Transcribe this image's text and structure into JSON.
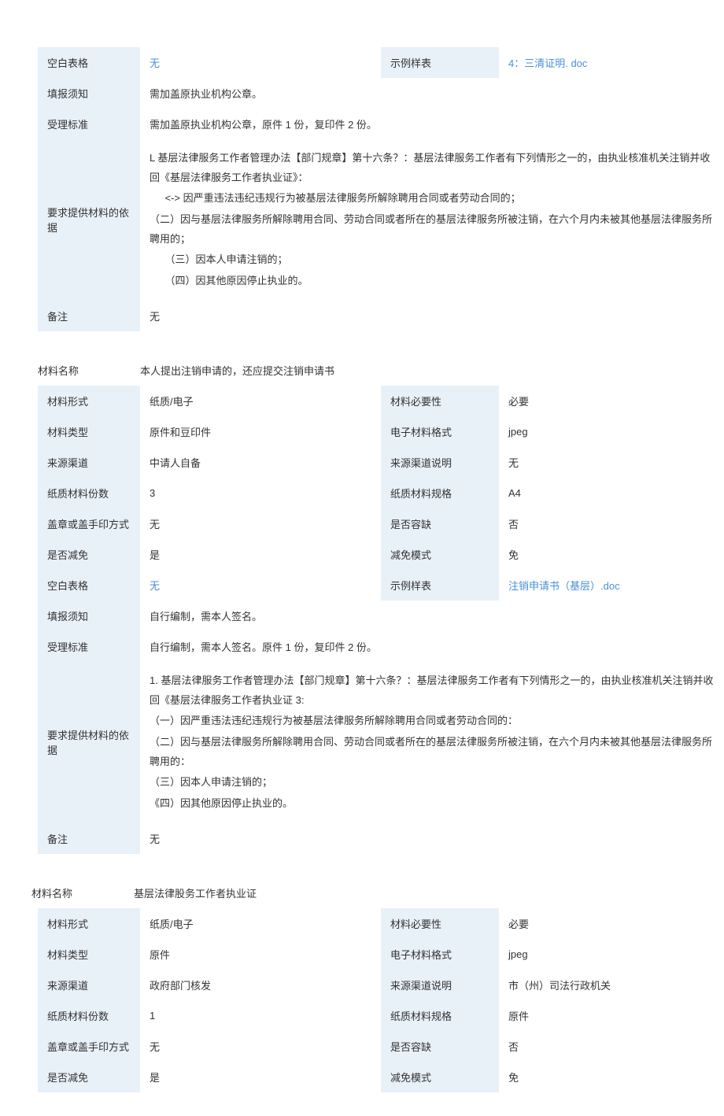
{
  "labels": {
    "blank_form": "空白表格",
    "sample": "示例样表",
    "fill_notice": "填报须知",
    "accept_std": "受理标准",
    "basis": "要求提供材料的依据",
    "remark": "备注",
    "mat_name": "材料名称",
    "mat_form": "材料形式",
    "mat_nec": "材料必要性",
    "mat_type": "材料类型",
    "e_format": "电子材料格式",
    "source": "来源渠道",
    "source_desc": "来源渠道说明",
    "paper_count": "纸质材料份数",
    "paper_spec": "纸质材料规格",
    "stamp": "盖章或盖手印方式",
    "allow_missing": "是否容缺",
    "reduce": "是否减免",
    "reduce_mode": "减免模式"
  },
  "s1": {
    "blank_form": "无",
    "sample": "4：三清证明. doc",
    "fill_notice": "需加盖原执业机构公章。",
    "accept_std": "需加盖原执业机构公章，原件 1 份，复印件 2 份。",
    "basis_l1": "L 基层法律服务工作者管理办法【部门规章】第十六条？：基层法律服务工作者有下列情形之一的，由执业核准机关注销并收回《基层法律服务工作者执业证》：",
    "basis_l2": "<->  因严重违法违纪违规行为被基层法律服务所解除聘用合同或者劳动合同的；",
    "basis_l3": "（二）因与基层法律服务所解除聘用合同、劳动合同或者所在的基层法律服务所被注销，在六个月内未被其他基层法律服务所聘用的；",
    "basis_l4": "（三）因本人申请注销的；",
    "basis_l5": "（四）因其他原因停止执业的。",
    "remark": "无"
  },
  "s2": {
    "mat_name": "本人提出注销申请的，还应提交注销申请书",
    "mat_form": "纸质/电子",
    "mat_nec": "必要",
    "mat_type": "原件和豆印件",
    "e_format": "jpeg",
    "source": "中请人自备",
    "source_desc": "无",
    "paper_count": "3",
    "paper_spec": "A4",
    "stamp": "无",
    "allow_missing": "否",
    "reduce": "是",
    "reduce_mode": "免",
    "blank_form": "无",
    "sample": "注销申请书（基层）.doc",
    "fill_notice": "自行编制，需本人签名。",
    "accept_std": "自行编制，需本人签名。原件 1 份，复印件 2 份。",
    "basis_l1": "1. 基层法律服务工作者管理办法【部门规章】第十六条？：基层法律服务工作者有下列情形之一的，由执业核准机关注销并收回《基层法律服务工作者执业证 3:",
    "basis_l2": "（一）因严重违法违纪违规行为被基层法律服务所解除聘用合同或者劳动合同的：",
    "basis_l3": "（二）因与基层法律服务所解除聘用合同、劳动合同或者所在的基层法律服务所被注销，在六个月内未被其他基层法律服务所聘用的：",
    "basis_l4": "（三）因本人申请注销的；",
    "basis_l5": "《四）因其他原因停止执业的。",
    "remark": "无"
  },
  "s3": {
    "mat_name": "基层法律股务工作者执业证",
    "mat_form": "纸质/电子",
    "mat_nec": "必要",
    "mat_type": "原件",
    "e_format": "jpeg",
    "source": "政府部门核发",
    "source_desc": "市（州）司法行政机关",
    "paper_count": "1",
    "paper_spec": "原件",
    "stamp": "无",
    "allow_missing": "否",
    "reduce": "是",
    "reduce_mode": "免"
  }
}
